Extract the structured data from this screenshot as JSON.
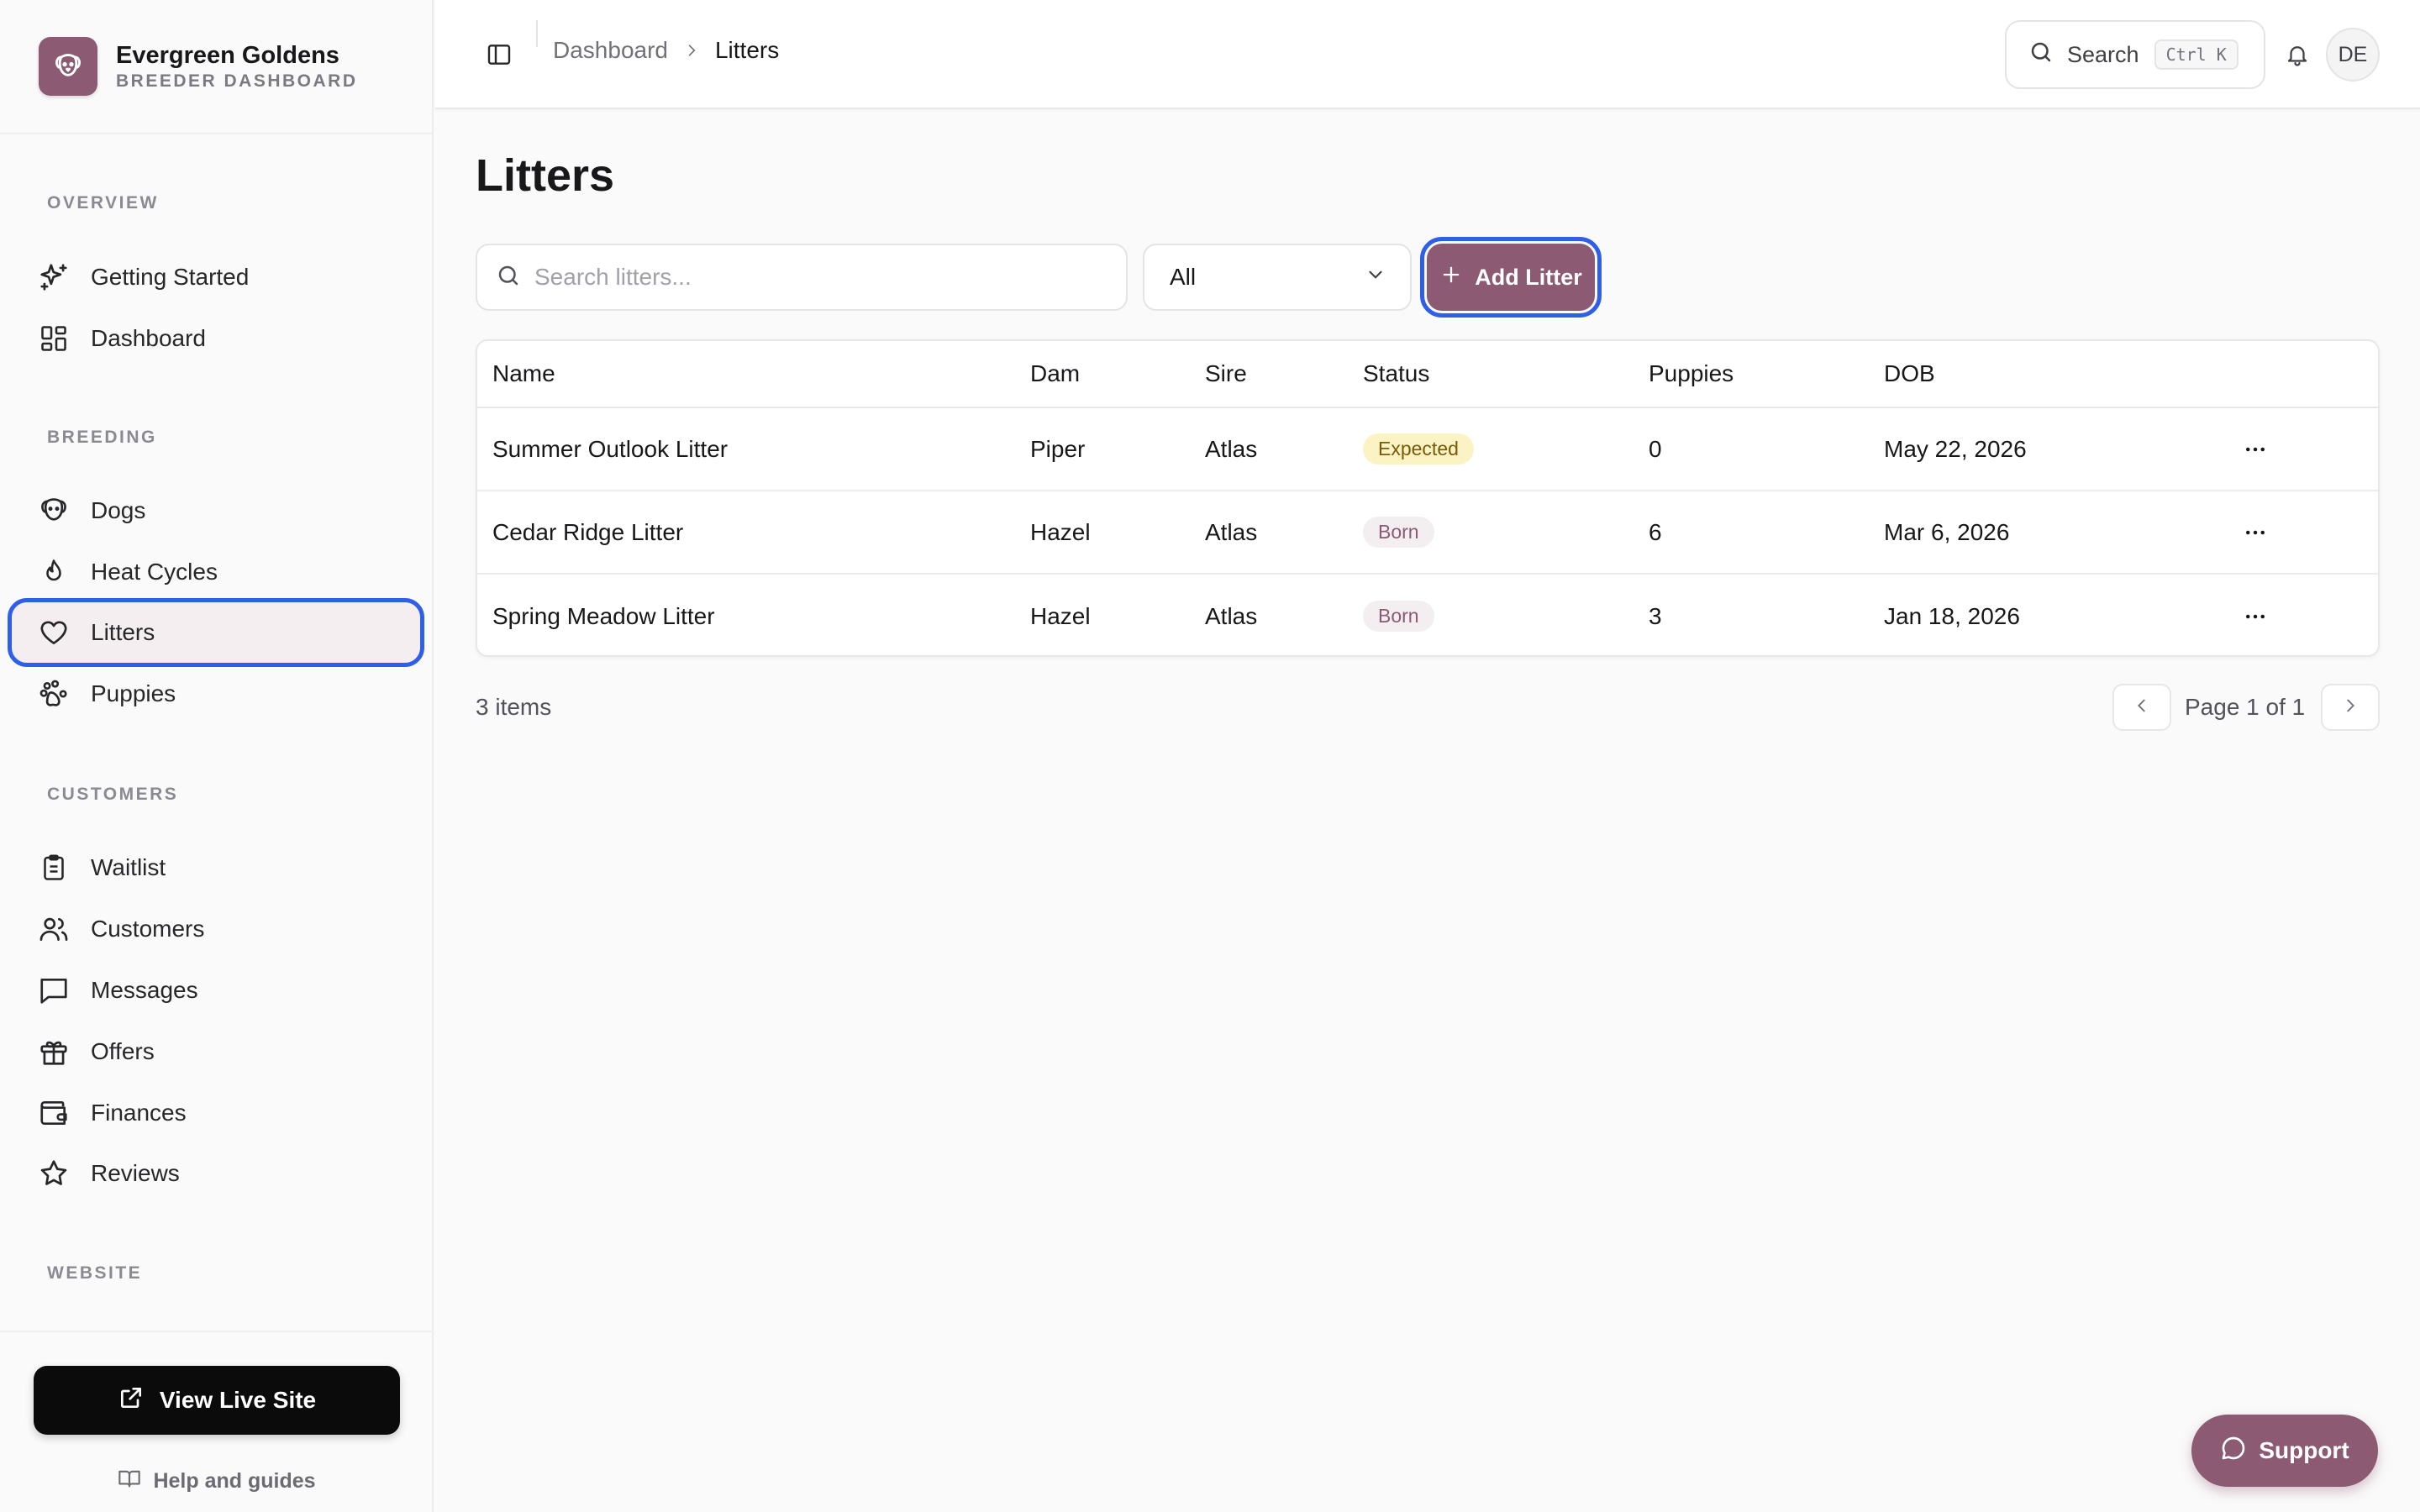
{
  "brand": {
    "name": "Evergreen Goldens",
    "subtitle": "BREEDER DASHBOARD",
    "logo_icon": "dog-face-icon"
  },
  "sidebar": {
    "sections": [
      {
        "label": "OVERVIEW",
        "items": [
          {
            "label": "Getting Started",
            "icon": "sparkles-icon"
          },
          {
            "label": "Dashboard",
            "icon": "grid-icon"
          }
        ]
      },
      {
        "label": "BREEDING",
        "items": [
          {
            "label": "Dogs",
            "icon": "dog-face-icon"
          },
          {
            "label": "Heat Cycles",
            "icon": "flame-icon"
          },
          {
            "label": "Litters",
            "icon": "heart-icon",
            "active": true
          },
          {
            "label": "Puppies",
            "icon": "paw-icon"
          }
        ]
      },
      {
        "label": "CUSTOMERS",
        "items": [
          {
            "label": "Waitlist",
            "icon": "clipboard-icon"
          },
          {
            "label": "Customers",
            "icon": "users-icon"
          },
          {
            "label": "Messages",
            "icon": "message-icon"
          },
          {
            "label": "Offers",
            "icon": "gift-icon"
          },
          {
            "label": "Finances",
            "icon": "wallet-icon"
          },
          {
            "label": "Reviews",
            "icon": "star-icon"
          }
        ]
      },
      {
        "label": "WEBSITE",
        "items": []
      }
    ],
    "live_site_label": "View Live Site",
    "help_label": "Help and guides"
  },
  "header": {
    "breadcrumb": [
      "Dashboard",
      "Litters"
    ],
    "search_label": "Search",
    "search_shortcut": "Ctrl K",
    "avatar_initials": "DE"
  },
  "main": {
    "title": "Litters",
    "search_placeholder": "Search litters...",
    "filter_value": "All",
    "add_label": "Add Litter",
    "columns": [
      "Name",
      "Dam",
      "Sire",
      "Status",
      "Puppies",
      "DOB"
    ],
    "rows": [
      {
        "name": "Summer Outlook Litter",
        "dam": "Piper",
        "sire": "Atlas",
        "status": "Expected",
        "puppies": "0",
        "dob": "May 22, 2026"
      },
      {
        "name": "Cedar Ridge Litter",
        "dam": "Hazel",
        "sire": "Atlas",
        "status": "Born",
        "puppies": "6",
        "dob": "Mar 6, 2026"
      },
      {
        "name": "Spring Meadow Litter",
        "dam": "Hazel",
        "sire": "Atlas",
        "status": "Born",
        "puppies": "3",
        "dob": "Jan 18, 2026"
      }
    ],
    "item_count": "3 items",
    "page_text": "Page 1 of 1"
  },
  "support_label": "Support",
  "colors": {
    "accent": "#8c5a72",
    "focus_ring": "#2f5fe8",
    "expected_bg": "#fbf3c4",
    "born_bg": "#f3eef0"
  }
}
